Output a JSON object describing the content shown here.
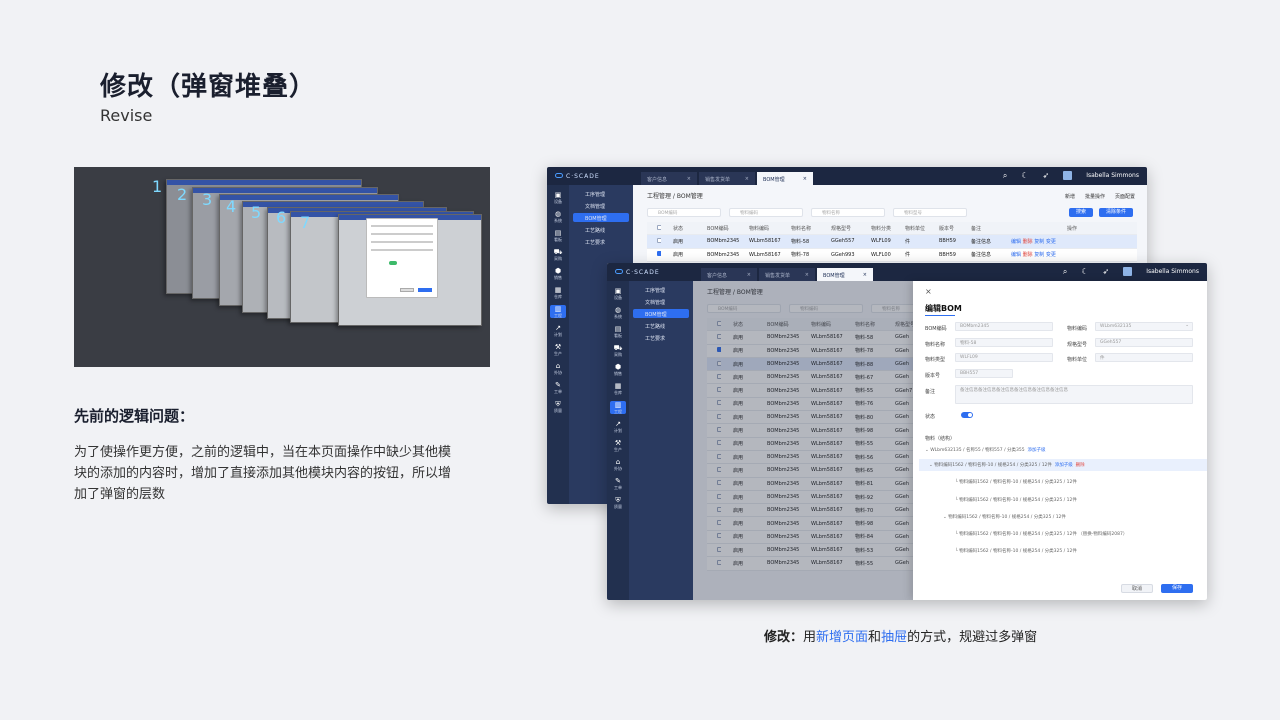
{
  "page": {
    "title": "修改（弹窗堆叠）",
    "subtitle": "Revise",
    "question_heading": "先前的逻辑问题：",
    "question_body": "为了使操作更方便，之前的逻辑中，当在本页面操作中缺少其他模块的添加的内容时，增加了直接添加其他模块内容的按钮，所以增加了弹窗的层数",
    "caption_prefix": "修改：",
    "caption_t1": "用",
    "caption_hl1": "新增页面",
    "caption_t2": "和",
    "caption_hl2": "抽屉",
    "caption_t3": "的方式，规避过多弹窗"
  },
  "old_layers": [
    "1",
    "2",
    "3",
    "4",
    "5",
    "6",
    "7"
  ],
  "app": {
    "logo": "C·SCADE",
    "tabs": [
      {
        "label": "客户信息",
        "close": "×"
      },
      {
        "label": "销售发货单",
        "close": "×"
      },
      {
        "label": "BOM管理",
        "close": "×"
      }
    ],
    "user": "Isabella Simmons",
    "sidebar": [
      "设备",
      "系统",
      "看板",
      "采购",
      "销售",
      "仓库",
      "工程",
      "计划",
      "生产",
      "外协",
      "工单",
      "质量"
    ],
    "nav": [
      "工序管理",
      "文档管理",
      "BOM管理",
      "工艺路线",
      "工艺要求"
    ],
    "breadcrumb": "工程管理 / BOM管理",
    "tools": [
      "新增",
      "批量操作",
      "页面配置"
    ],
    "search_placeholders": [
      "BOM编码",
      "物料编码",
      "物料名称",
      "物料型号"
    ],
    "btn_search": "搜索",
    "btn_reset": "清除条件",
    "columns": [
      "状态",
      "BOM编码",
      "物料编码",
      "物料名称",
      "规格型号",
      "物料分类",
      "物料单位",
      "版本号",
      "备注",
      "操作"
    ],
    "rows_back": [
      {
        "status": "启用",
        "bom": "BOMbm2345",
        "code": "WLbm58167",
        "name": "物料-58",
        "spec": "GGeh557",
        "cat": "WLFL09",
        "unit": "件",
        "ver": "BBH59",
        "note": "备注信息"
      },
      {
        "status": "启用",
        "bom": "BOMbm2345",
        "code": "WLbm58167",
        "name": "物料-78",
        "spec": "GGeh993",
        "cat": "WLFL00",
        "unit": "件",
        "ver": "BBH59",
        "note": "备注信息"
      }
    ],
    "ops": {
      "edit": "编辑",
      "del": "删除",
      "copy": "复制",
      "change": "变更"
    },
    "rows_front": [
      {
        "status": "启用",
        "bom": "BOMbm2345",
        "code": "WLbm58167",
        "name": "物料-58",
        "spec": "GGeh"
      },
      {
        "status": "启用",
        "bom": "BOMbm2345",
        "code": "WLbm58167",
        "name": "物料-78",
        "spec": "GGeh"
      },
      {
        "status": "启用",
        "bom": "BOMbm2345",
        "code": "WLbm58167",
        "name": "物料-88",
        "spec": "GGeh"
      },
      {
        "status": "启用",
        "bom": "BOMbm2345",
        "code": "WLbm58167",
        "name": "物料-67",
        "spec": "GGeh"
      },
      {
        "status": "启用",
        "bom": "BOMbm2345",
        "code": "WLbm58167",
        "name": "物料-55",
        "spec": "GGeh7"
      },
      {
        "status": "启用",
        "bom": "BOMbm2345",
        "code": "WLbm58167",
        "name": "物料-76",
        "spec": "GGeh"
      },
      {
        "status": "启用",
        "bom": "BOMbm2345",
        "code": "WLbm58167",
        "name": "物料-80",
        "spec": "GGeh"
      },
      {
        "status": "启用",
        "bom": "BOMbm2345",
        "code": "WLbm58167",
        "name": "物料-98",
        "spec": "GGeh"
      },
      {
        "status": "启用",
        "bom": "BOMbm2345",
        "code": "WLbm58167",
        "name": "物料-55",
        "spec": "GGeh"
      },
      {
        "status": "启用",
        "bom": "BOMbm2345",
        "code": "WLbm58167",
        "name": "物料-56",
        "spec": "GGeh"
      },
      {
        "status": "启用",
        "bom": "BOMbm2345",
        "code": "WLbm58167",
        "name": "物料-65",
        "spec": "GGeh"
      },
      {
        "status": "启用",
        "bom": "BOMbm2345",
        "code": "WLbm58167",
        "name": "物料-81",
        "spec": "GGeh"
      },
      {
        "status": "启用",
        "bom": "BOMbm2345",
        "code": "WLbm58167",
        "name": "物料-92",
        "spec": "GGeh"
      },
      {
        "status": "启用",
        "bom": "BOMbm2345",
        "code": "WLbm58167",
        "name": "物料-70",
        "spec": "GGeh"
      },
      {
        "status": "启用",
        "bom": "BOMbm2345",
        "code": "WLbm58167",
        "name": "物料-98",
        "spec": "GGeh"
      },
      {
        "status": "启用",
        "bom": "BOMbm2345",
        "code": "WLbm58167",
        "name": "物料-84",
        "spec": "GGeh"
      },
      {
        "status": "启用",
        "bom": "BOMbm2345",
        "code": "WLbm58167",
        "name": "物料-53",
        "spec": "GGeh"
      },
      {
        "status": "启用",
        "bom": "BOMbm2345",
        "code": "WLbm58167",
        "name": "物料-55",
        "spec": "GGeh"
      }
    ]
  },
  "drawer": {
    "close": "×",
    "title": "编辑BOM",
    "fields": [
      {
        "label": "BOM编码",
        "value": "BOMbm2345"
      },
      {
        "label": "物料编码",
        "value": "WLbm632135"
      },
      {
        "label": "物料名称",
        "value": "物料-58"
      },
      {
        "label": "规格型号",
        "value": "GGeh557"
      },
      {
        "label": "物料类型",
        "value": "WLFL09"
      },
      {
        "label": "物料单位",
        "value": "件"
      },
      {
        "label": "版本号",
        "value": "BBH557"
      },
      {
        "label": "备注",
        "value": "备注信息备注信息备注信息备注信息备注信息备注信息"
      },
      {
        "label": "状态",
        "value": ""
      }
    ],
    "tree_title": "物料（结构）",
    "tree": [
      "WLbm632135 / 名称55 / 物料557 / 分类355",
      "物料编码1562 / 物料名称-10 / 规格254 / 分类325 / 12件",
      "物料编码1562 / 物料名称-10 / 规格254 / 分类325 / 12件",
      "物料编码1562 / 物料名称-10 / 规格254 / 分类325 / 12件",
      "物料编码1562 / 物料名称-10 / 规格254 / 分类325 / 12件",
      "物料编码1562 / 物料名称-10 / 规格254 / 分类325 / 12件  （替换-物料编码2087）",
      "物料编码1562 / 物料名称-10 / 规格254 / 分类325 / 12件"
    ],
    "add_child": "添加子级",
    "del": "删除",
    "cancel": "取消",
    "save": "保存"
  },
  "colors": {
    "accent": "#2e6ef0",
    "topbar": "#1c2741",
    "sidebar": "#22304f",
    "danger": "#e0443c"
  }
}
